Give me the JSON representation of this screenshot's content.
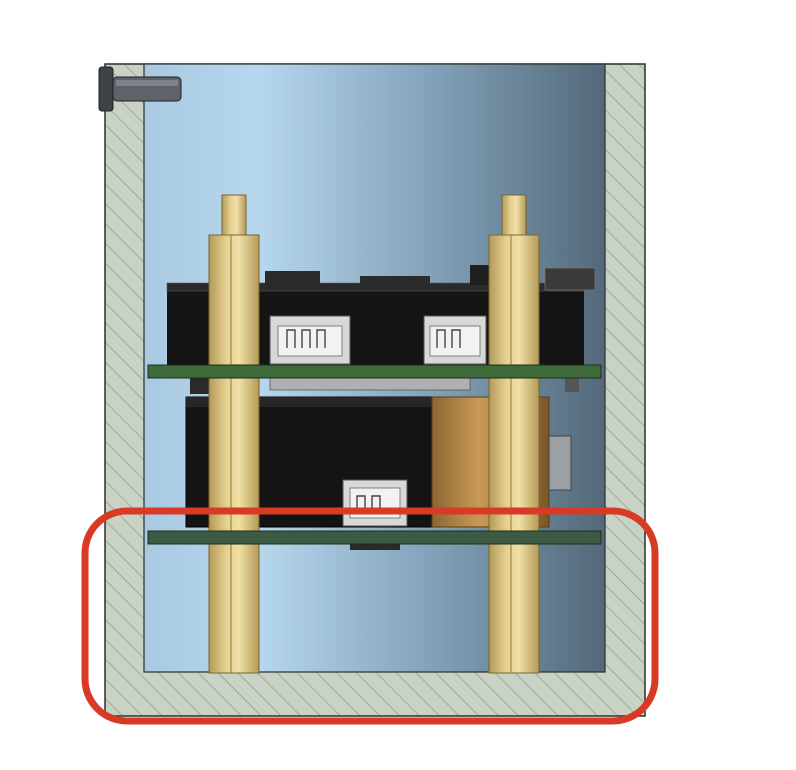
{
  "diagram": {
    "kind": "enclosure-cross-section",
    "colors": {
      "background": "#ffffff",
      "wall_fill": "#c9d3c5",
      "wall_hatch": "#8f978c",
      "wall_outline": "#2b2f2b",
      "interior_light": "#b7d7ee",
      "interior_dark": "#53697a",
      "standoff": "#e6d190",
      "standoff_shade": "#b49a58",
      "pcb_green": "#3f6b3a",
      "pcb_lower": "#3d5a45",
      "module_black": "#141414",
      "capacitor": "#b78a4a",
      "connector": "#d8d8d8",
      "screw": "#5d6368",
      "highlight": "#d93a26"
    },
    "parts": {
      "enclosure": "enclosure-wall",
      "standoffs": [
        "standoff-left",
        "standoff-right"
      ],
      "upper_board": "upper-pcb",
      "lower_board": "lower-pcb",
      "module": "black-module",
      "screw": "lid-screw"
    },
    "annotation": {
      "shape": "rounded-rectangle",
      "color": "#d93a26",
      "target": "lower-standoff-region"
    }
  }
}
